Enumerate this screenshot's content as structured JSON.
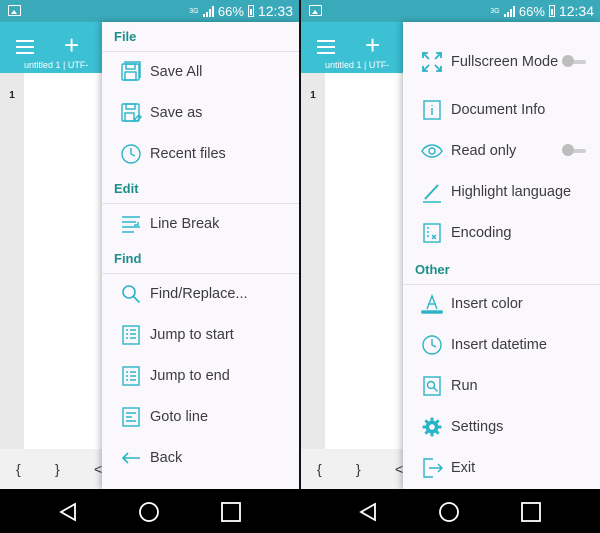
{
  "left": {
    "status": {
      "battery": "66%",
      "time": "12:33",
      "net": "3G"
    },
    "tab_info": "untitled 1  |  UTF-",
    "line_number": "1",
    "bottom": {
      "open_brace": "{",
      "close_brace": "}",
      "lt": "<"
    },
    "drawer": {
      "sections": [
        {
          "title": "File",
          "items": [
            {
              "label": "Save All",
              "icon": "save-all-icon"
            },
            {
              "label": "Save as",
              "icon": "save-as-icon"
            },
            {
              "label": "Recent files",
              "icon": "clock-icon"
            }
          ]
        },
        {
          "title": "Edit",
          "items": [
            {
              "label": "Line Break",
              "icon": "line-break-icon"
            }
          ]
        },
        {
          "title": "Find",
          "items": [
            {
              "label": "Find/Replace...",
              "icon": "search-icon"
            },
            {
              "label": "Jump to start",
              "icon": "jump-start-icon"
            },
            {
              "label": "Jump to end",
              "icon": "jump-end-icon"
            },
            {
              "label": "Goto line",
              "icon": "goto-line-icon"
            },
            {
              "label": "Back",
              "icon": "arrow-left-icon"
            }
          ]
        }
      ]
    }
  },
  "right": {
    "status": {
      "battery": "66%",
      "time": "12:34",
      "net": "3G"
    },
    "tab_info": "untitled 1  |  UTF-",
    "line_number": "1",
    "bottom": {
      "open_brace": "{",
      "close_brace": "}",
      "lt": "<"
    },
    "drawer": {
      "items_top": [
        {
          "label": "Fullscreen Mode",
          "icon": "fullscreen-icon",
          "toggle": false
        },
        {
          "label": "Document Info",
          "icon": "info-icon"
        },
        {
          "label": "Read only",
          "icon": "eye-icon",
          "toggle": false
        },
        {
          "label": "Highlight language",
          "icon": "pen-icon"
        },
        {
          "label": "Encoding",
          "icon": "encoding-icon"
        }
      ],
      "other_title": "Other",
      "items_other": [
        {
          "label": "Insert color",
          "icon": "font-color-icon"
        },
        {
          "label": "Insert datetime",
          "icon": "clock-icon"
        },
        {
          "label": "Run",
          "icon": "run-icon"
        },
        {
          "label": "Settings",
          "icon": "gear-icon"
        },
        {
          "label": "Exit",
          "icon": "exit-icon"
        }
      ]
    }
  },
  "colors": {
    "accent": "#3cc1d4",
    "status": "#3aa9b9",
    "section": "#1d8f8a",
    "icon": "#2ab5c6"
  }
}
